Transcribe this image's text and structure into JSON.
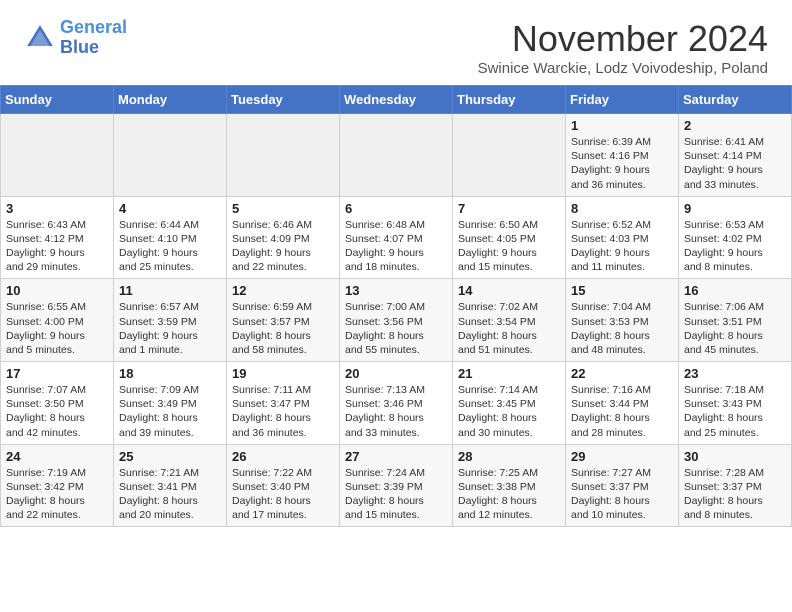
{
  "header": {
    "logo_line1": "General",
    "logo_line2": "Blue",
    "month_title": "November 2024",
    "subtitle": "Swinice Warckie, Lodz Voivodeship, Poland"
  },
  "days_of_week": [
    "Sunday",
    "Monday",
    "Tuesday",
    "Wednesday",
    "Thursday",
    "Friday",
    "Saturday"
  ],
  "weeks": [
    [
      {
        "day": "",
        "info": ""
      },
      {
        "day": "",
        "info": ""
      },
      {
        "day": "",
        "info": ""
      },
      {
        "day": "",
        "info": ""
      },
      {
        "day": "",
        "info": ""
      },
      {
        "day": "1",
        "info": "Sunrise: 6:39 AM\nSunset: 4:16 PM\nDaylight: 9 hours\nand 36 minutes."
      },
      {
        "day": "2",
        "info": "Sunrise: 6:41 AM\nSunset: 4:14 PM\nDaylight: 9 hours\nand 33 minutes."
      }
    ],
    [
      {
        "day": "3",
        "info": "Sunrise: 6:43 AM\nSunset: 4:12 PM\nDaylight: 9 hours\nand 29 minutes."
      },
      {
        "day": "4",
        "info": "Sunrise: 6:44 AM\nSunset: 4:10 PM\nDaylight: 9 hours\nand 25 minutes."
      },
      {
        "day": "5",
        "info": "Sunrise: 6:46 AM\nSunset: 4:09 PM\nDaylight: 9 hours\nand 22 minutes."
      },
      {
        "day": "6",
        "info": "Sunrise: 6:48 AM\nSunset: 4:07 PM\nDaylight: 9 hours\nand 18 minutes."
      },
      {
        "day": "7",
        "info": "Sunrise: 6:50 AM\nSunset: 4:05 PM\nDaylight: 9 hours\nand 15 minutes."
      },
      {
        "day": "8",
        "info": "Sunrise: 6:52 AM\nSunset: 4:03 PM\nDaylight: 9 hours\nand 11 minutes."
      },
      {
        "day": "9",
        "info": "Sunrise: 6:53 AM\nSunset: 4:02 PM\nDaylight: 9 hours\nand 8 minutes."
      }
    ],
    [
      {
        "day": "10",
        "info": "Sunrise: 6:55 AM\nSunset: 4:00 PM\nDaylight: 9 hours\nand 5 minutes."
      },
      {
        "day": "11",
        "info": "Sunrise: 6:57 AM\nSunset: 3:59 PM\nDaylight: 9 hours\nand 1 minute."
      },
      {
        "day": "12",
        "info": "Sunrise: 6:59 AM\nSunset: 3:57 PM\nDaylight: 8 hours\nand 58 minutes."
      },
      {
        "day": "13",
        "info": "Sunrise: 7:00 AM\nSunset: 3:56 PM\nDaylight: 8 hours\nand 55 minutes."
      },
      {
        "day": "14",
        "info": "Sunrise: 7:02 AM\nSunset: 3:54 PM\nDaylight: 8 hours\nand 51 minutes."
      },
      {
        "day": "15",
        "info": "Sunrise: 7:04 AM\nSunset: 3:53 PM\nDaylight: 8 hours\nand 48 minutes."
      },
      {
        "day": "16",
        "info": "Sunrise: 7:06 AM\nSunset: 3:51 PM\nDaylight: 8 hours\nand 45 minutes."
      }
    ],
    [
      {
        "day": "17",
        "info": "Sunrise: 7:07 AM\nSunset: 3:50 PM\nDaylight: 8 hours\nand 42 minutes."
      },
      {
        "day": "18",
        "info": "Sunrise: 7:09 AM\nSunset: 3:49 PM\nDaylight: 8 hours\nand 39 minutes."
      },
      {
        "day": "19",
        "info": "Sunrise: 7:11 AM\nSunset: 3:47 PM\nDaylight: 8 hours\nand 36 minutes."
      },
      {
        "day": "20",
        "info": "Sunrise: 7:13 AM\nSunset: 3:46 PM\nDaylight: 8 hours\nand 33 minutes."
      },
      {
        "day": "21",
        "info": "Sunrise: 7:14 AM\nSunset: 3:45 PM\nDaylight: 8 hours\nand 30 minutes."
      },
      {
        "day": "22",
        "info": "Sunrise: 7:16 AM\nSunset: 3:44 PM\nDaylight: 8 hours\nand 28 minutes."
      },
      {
        "day": "23",
        "info": "Sunrise: 7:18 AM\nSunset: 3:43 PM\nDaylight: 8 hours\nand 25 minutes."
      }
    ],
    [
      {
        "day": "24",
        "info": "Sunrise: 7:19 AM\nSunset: 3:42 PM\nDaylight: 8 hours\nand 22 minutes."
      },
      {
        "day": "25",
        "info": "Sunrise: 7:21 AM\nSunset: 3:41 PM\nDaylight: 8 hours\nand 20 minutes."
      },
      {
        "day": "26",
        "info": "Sunrise: 7:22 AM\nSunset: 3:40 PM\nDaylight: 8 hours\nand 17 minutes."
      },
      {
        "day": "27",
        "info": "Sunrise: 7:24 AM\nSunset: 3:39 PM\nDaylight: 8 hours\nand 15 minutes."
      },
      {
        "day": "28",
        "info": "Sunrise: 7:25 AM\nSunset: 3:38 PM\nDaylight: 8 hours\nand 12 minutes."
      },
      {
        "day": "29",
        "info": "Sunrise: 7:27 AM\nSunset: 3:37 PM\nDaylight: 8 hours\nand 10 minutes."
      },
      {
        "day": "30",
        "info": "Sunrise: 7:28 AM\nSunset: 3:37 PM\nDaylight: 8 hours\nand 8 minutes."
      }
    ]
  ]
}
